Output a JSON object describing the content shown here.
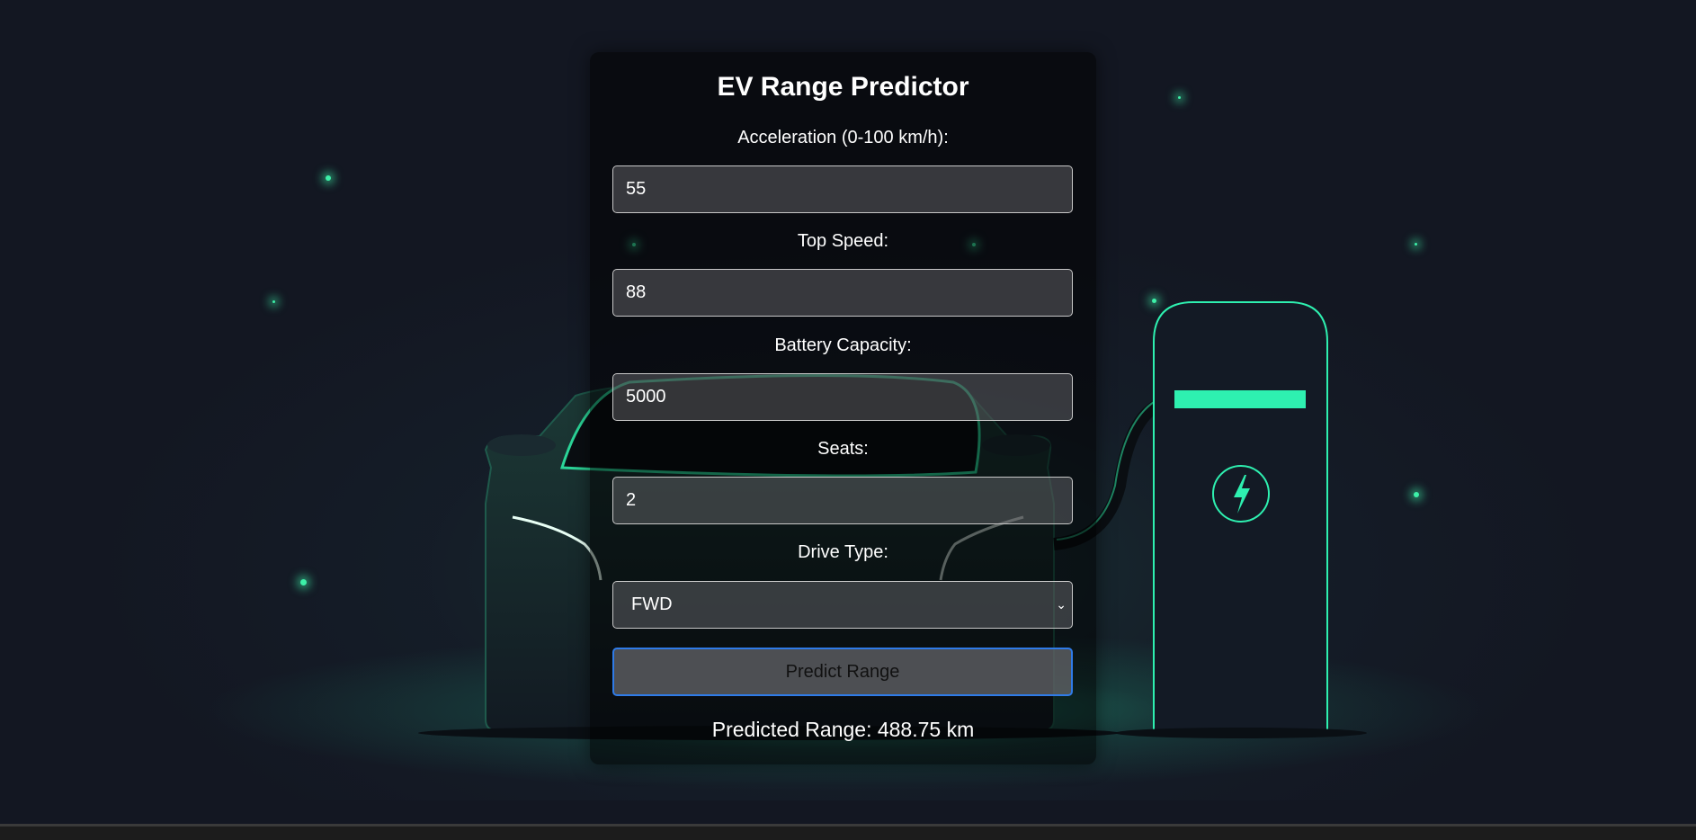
{
  "app": {
    "title": "EV Range Predictor"
  },
  "form": {
    "acceleration": {
      "label": "Acceleration (0-100 km/h):",
      "value": "55"
    },
    "top_speed": {
      "label": "Top Speed:",
      "value": "88"
    },
    "battery_capacity": {
      "label": "Battery Capacity:",
      "value": "5000"
    },
    "seats": {
      "label": "Seats:",
      "value": "2"
    },
    "drive_type": {
      "label": "Drive Type:",
      "value": "FWD"
    },
    "submit_label": "Predict Range"
  },
  "result": {
    "text": "Predicted Range: 488.75 km"
  },
  "theme": {
    "accent": "#2ef0b0",
    "background": "#131722",
    "button_border": "#2f7be8"
  },
  "icons": {
    "charger_bolt": "lightning-bolt-icon",
    "select_chevron": "chevron-down-icon"
  }
}
